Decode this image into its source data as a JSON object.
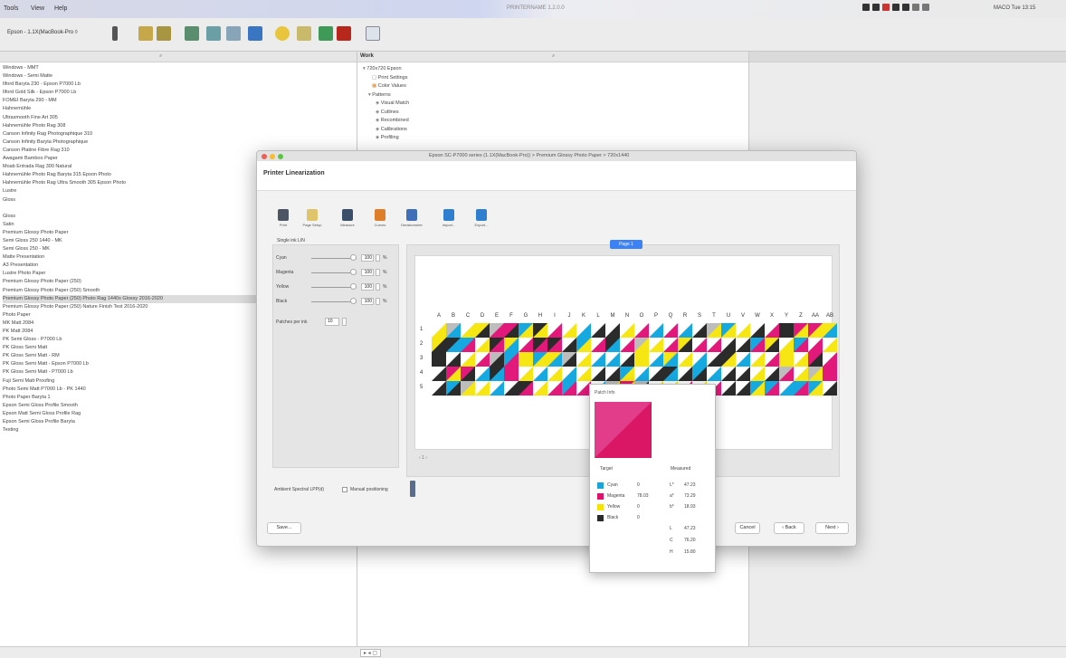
{
  "menubar": {
    "items": [
      "Tools",
      "View",
      "Help"
    ],
    "window_title": "PRINTERNAME 1.2.0.0",
    "status_text": "MACO  Tue 13:15"
  },
  "toolbar": {
    "printer": "Epson - 1.1X(MacBook-Pro ◊"
  },
  "left_list": {
    "items": [
      "Windows - MMT",
      "Windows - Semi Matte",
      "Ilford Baryta 230 - Epson P7000 Lb",
      "Ilford Gold Silk - Epson P7000 Lb",
      "FOMEI Baryta 290 - MM",
      "Hahnemühle",
      "Ultrasmooth Fine Art 305",
      "Hahnemühle Photo Rag 308",
      "Canson Infinity Rag Photographique 310",
      "Canson Infinity Baryta Photographique",
      "Canson Platine Fibre Rag 310",
      "Awagami Bamboo Paper",
      "Moab Entrada Rag 300 Natural",
      "Hahnemühle Photo Rag Baryta 315 Epson Photo",
      "Hahnemühle Photo Rag Ultra Smooth 305 Epson Photo",
      "Lustre",
      "Gloss",
      "",
      "Gloss",
      "Satin",
      "Premium Glossy Photo Paper",
      "Semi Gloss 250 1440 - MK",
      "Semi Gloss 250 - MK",
      "Matte Presentation",
      "A3 Presentation",
      "Lustre Photo Paper",
      "Premium Glossy Photo Paper (250)",
      "Premium Glossy Photo Paper (250) Smooth",
      "Premium Glossy Photo Paper (250) Photo Rag 1440x Glossy 2016-2020",
      "Premium Glossy Photo Paper (250) Nature Finish Test 2016-2020",
      "Photo Paper",
      "MK Matt 2084",
      "PK Matt 2084",
      "PK Semi Gloss - P7000 Lb",
      "PK Gloss Semi Matt",
      "PK Gloss Semi Matt - RM",
      "PK Gloss Semi Matt - Epson P7000 Lb",
      "PK Gloss Semi Matt - P7000 Lb",
      "Fuji Semi Matt Proofing",
      "Photo Semi Matt P7000 Lb - PK 1440",
      "Photo Paper Baryta 1",
      "Epson Semi Gloss Profile Smooth",
      "Epson Matt Semi Gloss Profile Rag",
      "Epson Semi Gloss Profile Baryta",
      "Testing"
    ]
  },
  "tree": {
    "title": "Work",
    "items": [
      "720x720 Epson",
      "Print Settings",
      "Color Values",
      "Patterns",
      "Visual Match",
      "Cutlines",
      "Recombined",
      "Calibrations",
      "Profiling"
    ]
  },
  "dialog": {
    "title": "Epson SC-P7000 series (1.1X(MacBook-Pro)) > Premium Glossy Photo Paper > 720x1440",
    "heading": "Printer Linearization",
    "tools": [
      "Print",
      "Page Setup",
      "Measure",
      "Curves",
      "Densitometer",
      "Import...",
      "Export..."
    ],
    "left_title": "Single ink LIN",
    "channels": [
      {
        "name": "Cyan",
        "value": "100",
        "unit": "%"
      },
      {
        "name": "Magenta",
        "value": "100",
        "unit": "%"
      },
      {
        "name": "Yellow",
        "value": "100",
        "unit": "%"
      },
      {
        "name": "Black",
        "value": "100",
        "unit": "%"
      }
    ],
    "patches_label": "Patches per ink",
    "patches_value": "10",
    "page_button": "Page 1",
    "columns": [
      "A",
      "B",
      "C",
      "D",
      "E",
      "F",
      "G",
      "H",
      "I",
      "J",
      "K",
      "L",
      "M",
      "N",
      "O",
      "P",
      "Q",
      "R",
      "S",
      "T",
      "U",
      "V",
      "W",
      "X",
      "Y",
      "Z",
      "AA",
      "AB"
    ],
    "rows": [
      "1",
      "2",
      "3",
      "4",
      "5"
    ],
    "page_nav": "‹ 1 ›",
    "options_label": "Ambient Spectral LPP(d)",
    "manual_label": "Manual positioning",
    "buttons": {
      "save": "Save...",
      "cancel": "Cancel",
      "back": "‹ Back",
      "next": "Next ›"
    }
  },
  "patch_info": {
    "title": "Patch Info",
    "target_label": "Target",
    "measured_label": "Measured",
    "target": [
      {
        "name": "Cyan",
        "value": "0",
        "color": "#1aa3dd"
      },
      {
        "name": "Magenta",
        "value": "78.03",
        "color": "#e2126a"
      },
      {
        "name": "Yellow",
        "value": "0",
        "color": "#f7e300"
      },
      {
        "name": "Black",
        "value": "0",
        "color": "#2a2a2a"
      }
    ],
    "measured": [
      {
        "k": "L*",
        "v": "47.23"
      },
      {
        "k": "a*",
        "v": "73.29"
      },
      {
        "k": "b*",
        "v": "18.93"
      },
      {
        "k": "L",
        "v": "47.23"
      },
      {
        "k": "C",
        "v": "76.20"
      },
      {
        "k": "H",
        "v": "15.80"
      }
    ]
  },
  "colors": {
    "cyan": "#16a8e0",
    "magenta": "#e2197b",
    "yellow": "#f5e614",
    "black": "#2b2b2b",
    "accent": "#3b82f6"
  }
}
